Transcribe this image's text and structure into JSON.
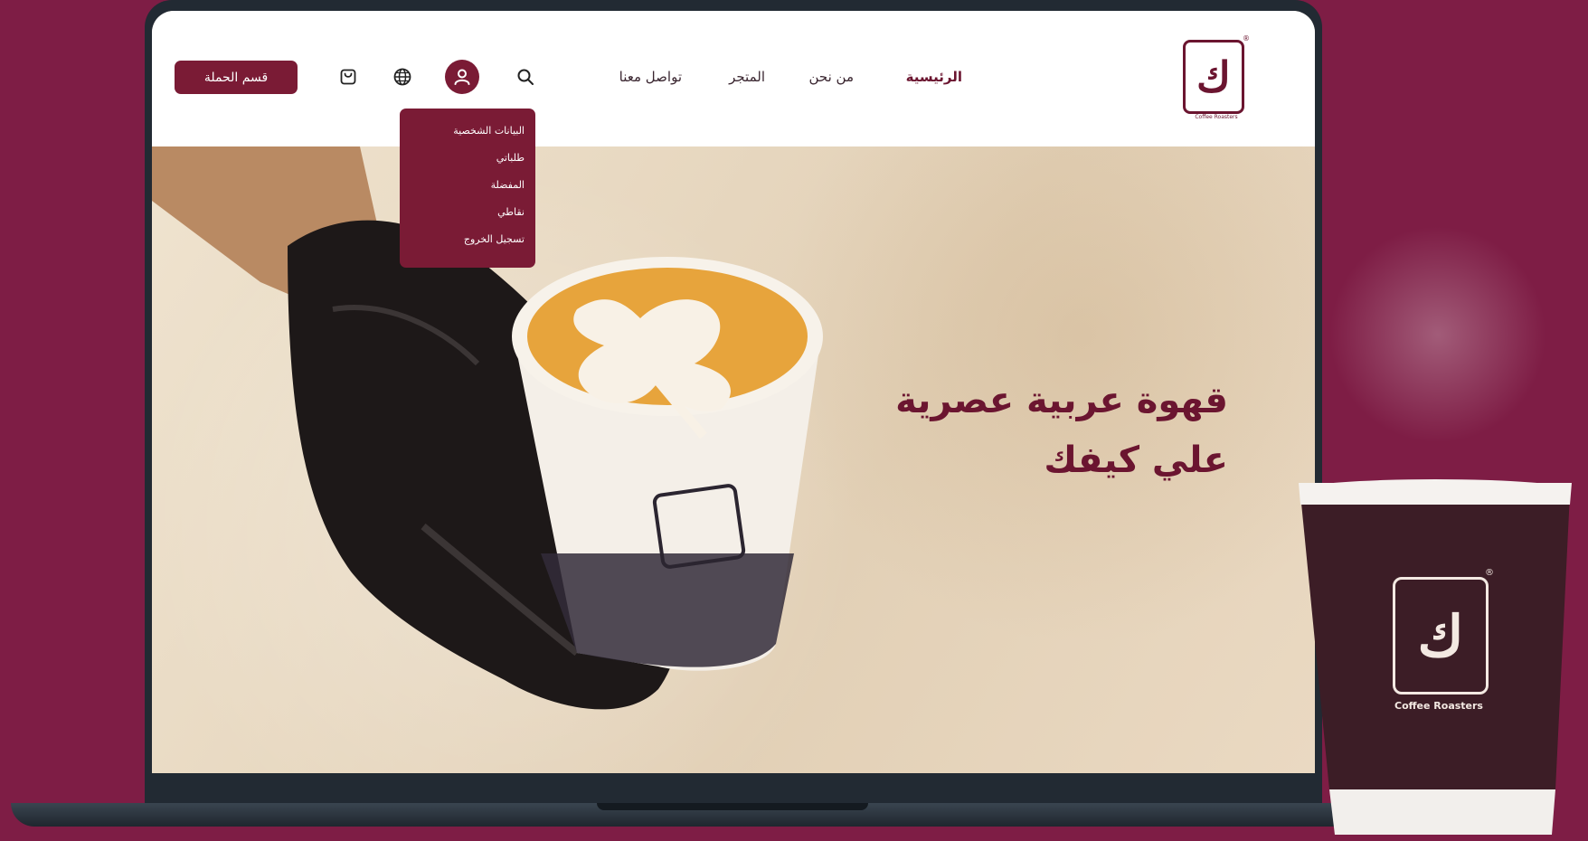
{
  "nav": {
    "logo_letter": "ك",
    "logo_registered": "®",
    "logo_caption": "Coffee Roasters",
    "links": [
      {
        "label": "الرئيسية",
        "active": true
      },
      {
        "label": "من نحن",
        "active": false
      },
      {
        "label": "المتجر",
        "active": false
      },
      {
        "label": "تواصل معنا",
        "active": false
      }
    ],
    "icons": [
      "search-icon",
      "user-icon",
      "globe-icon",
      "shopping-bag-icon"
    ],
    "cta_label": "قسم الحملة"
  },
  "dropdown": {
    "items": [
      "البيانات الشخصية",
      "طلباتي",
      "المفضلة",
      "نقاطي",
      "تسجيل الخروج"
    ]
  },
  "hero": {
    "title_line1": "قهوة عربية عصرية",
    "title_line2": "علي كيفك"
  },
  "product_cup": {
    "logo_letter": "ك",
    "registered": "®",
    "caption": "Coffee Roasters"
  },
  "colors": {
    "brand": "#7a1b35",
    "background": "#7e1d45",
    "nav_bg": "#ffffff"
  }
}
